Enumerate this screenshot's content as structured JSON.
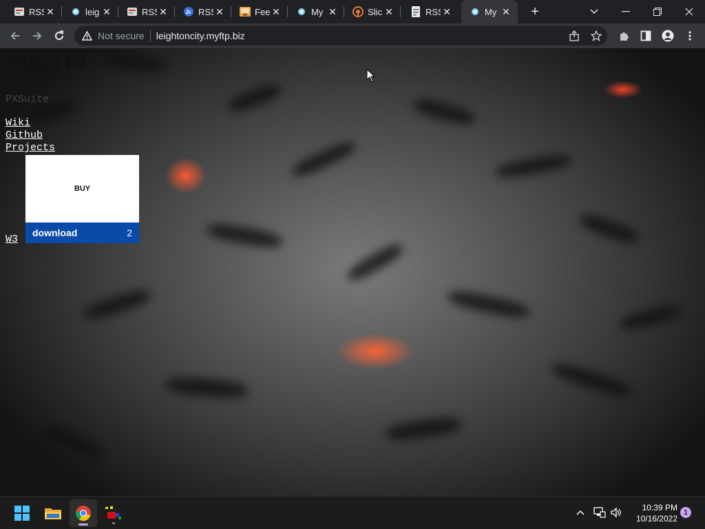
{
  "browser": {
    "tabs": [
      {
        "title": "RSS",
        "icon": "rss-feed-icon",
        "active": false
      },
      {
        "title": "leig",
        "icon": "site-dot-icon",
        "active": false
      },
      {
        "title": "RSS",
        "icon": "rss-feed-icon",
        "active": false
      },
      {
        "title": "RSS",
        "icon": "rss-reader-icon",
        "active": false
      },
      {
        "title": "Fee",
        "icon": "feed-image-icon",
        "active": false
      },
      {
        "title": "My",
        "icon": "site-dot-icon",
        "active": false
      },
      {
        "title": "Slic",
        "icon": "broadcast-icon",
        "active": false
      },
      {
        "title": "RSS",
        "icon": "document-icon",
        "active": false
      },
      {
        "title": "My",
        "icon": "site-dot-icon",
        "active": true
      }
    ],
    "new_tab_symbol": "+",
    "address": {
      "security_label": "Not secure",
      "url": "leightoncity.myftp.biz"
    }
  },
  "page": {
    "title": "PXSuite",
    "subtitle": "PXSuite",
    "links": [
      "Wiki",
      "Github",
      "Projects"
    ],
    "w3_link": "W3",
    "card": {
      "buy_label": "BUY",
      "download_label": "download",
      "download_count": "2"
    }
  },
  "taskbar": {
    "apps": [
      "start-icon",
      "file-explorer-icon",
      "chrome-icon",
      "paint-app-icon"
    ],
    "time": "10:39 PM",
    "date": "10/16/2022",
    "notification_count": "1"
  }
}
